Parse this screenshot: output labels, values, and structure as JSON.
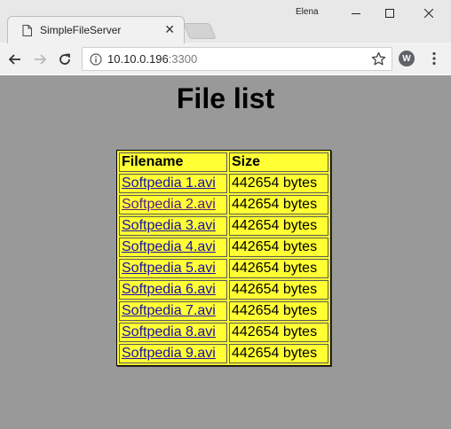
{
  "window": {
    "username": "Elena"
  },
  "tab": {
    "title": "SimpleFileServer",
    "close_glyph": "✕"
  },
  "toolbar": {
    "url_host": "10.10.0.196",
    "url_port": ":3300",
    "extension_letter": "W"
  },
  "page": {
    "title": "File list",
    "columns": [
      "Filename",
      "Size"
    ],
    "files": [
      {
        "name": "Softpedia 1.avi",
        "size": "442654 bytes"
      },
      {
        "name": "Softpedia 2.avi",
        "size": "442654 bytes"
      },
      {
        "name": "Softpedia 3.avi",
        "size": "442654 bytes"
      },
      {
        "name": "Softpedia 4.avi",
        "size": "442654 bytes"
      },
      {
        "name": "Softpedia 5.avi",
        "size": "442654 bytes"
      },
      {
        "name": "Softpedia 6.avi",
        "size": "442654 bytes"
      },
      {
        "name": "Softpedia 7.avi",
        "size": "442654 bytes"
      },
      {
        "name": "Softpedia 8.avi",
        "size": "442654 bytes"
      },
      {
        "name": "Softpedia 9.avi",
        "size": "442654 bytes"
      }
    ]
  },
  "colors": {
    "page_background": "#999999",
    "table_background": "#ffff33",
    "link": "#1a0dab"
  }
}
